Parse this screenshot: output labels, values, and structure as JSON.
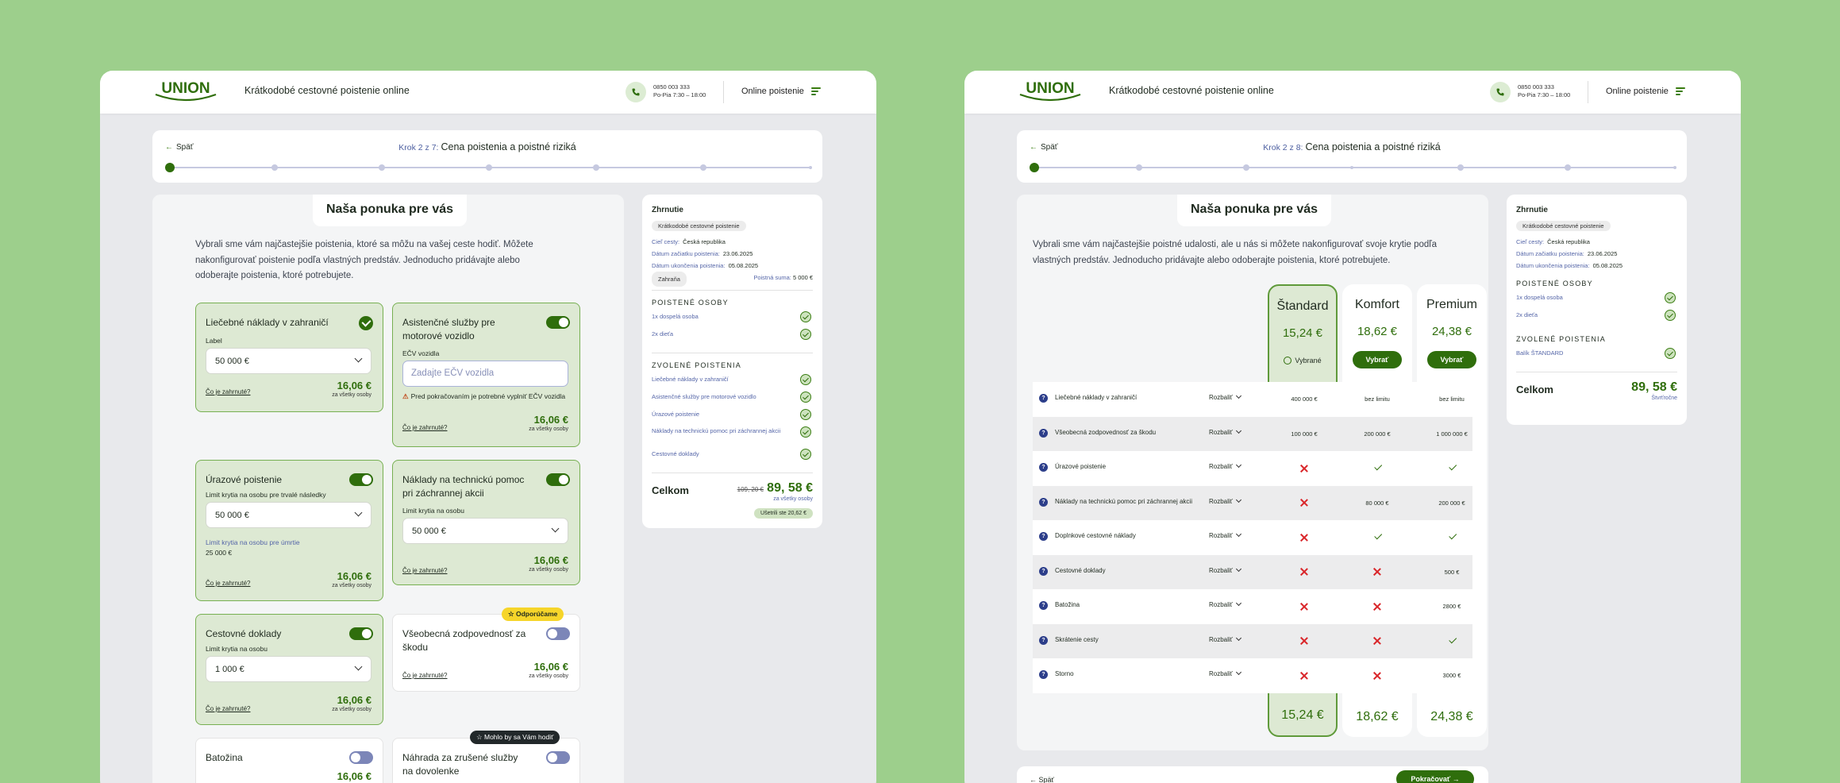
{
  "brand": {
    "logo": "UNION",
    "header_title": "Krátkodobé cestovné poistenie online",
    "phone": "0850 003 333",
    "hours": "Po-Pia 7:30 – 18:00",
    "menu_label": "Online poistenie",
    "accent": "#2f6e0c",
    "bg": "#9dcf8c"
  },
  "left": {
    "back": "Späť",
    "step_prefix": "Krok 2 z 7:",
    "step_title": "Cena poistenia a poistné riziká",
    "section_title": "Naša ponuka pre vás",
    "intro": "Vybrali sme vám najčastejšie poistenia, ktoré sa môžu na vašej ceste hodiť. Môžete nakonfigurovať poistenie podľa vlastných predstáv. Jednoducho pridávajte alebo odoberajte poistenia, ktoré potrebujete.",
    "cards": {
      "medical": {
        "title": "Liečebné náklady v zahraničí",
        "label": "Label",
        "value": "50 000 €",
        "price": "16,06 €",
        "per": "za všetky osoby",
        "link": "Čo je zahrnuté?"
      },
      "assist": {
        "title": "Asistenčné služby pre motorové vozidlo",
        "label": "EČV vozidla",
        "placeholder": "Zadajte EČV vozidla",
        "warning": "Pred pokračovaním je potrebné vyplniť EČV vozidla",
        "price": "16,06 €",
        "per": "za všetky osoby",
        "link": "Čo je zahrnuté?"
      },
      "injury": {
        "title": "Úrazové poistenie",
        "label": "Limit krytia na osobu pre trvalé následky",
        "value": "50 000 €",
        "label2": "Limit krytia na osobu pre úmrtie",
        "value2": "25 000 €",
        "price": "16,06 €",
        "per": "za všetky osoby",
        "link": "Čo je zahrnuté?"
      },
      "rescue": {
        "title": "Náklady na technickú pomoc pri záchrannej akcii",
        "label": "Limit krytia na osobu",
        "value": "50 000 €",
        "price": "16,06 €",
        "per": "za všetky osoby",
        "link": "Čo je zahrnuté?"
      },
      "docs": {
        "title": "Cestovné doklady",
        "label": "Limit krytia na osobu",
        "value": "1 000 €",
        "price": "16,06 €",
        "per": "za všetky osoby",
        "link": "Čo je zahrnuté?"
      },
      "liability": {
        "badge": "Odporúčame",
        "title": "Všeobecná zodpovednosť za škodu",
        "price": "16,06 €",
        "per": "za všetky osoby",
        "link": "Čo je zahrnuté?"
      },
      "luggage": {
        "title": "Batožina",
        "price": "16,06 €"
      },
      "cancel": {
        "badge": "Mohlo by sa Vám hodiť",
        "title": "Náhrada za zrušené služby na dovolenke"
      }
    },
    "summary": {
      "title": "Zhrnutie",
      "pill": "Krátkodobé cestovné poistenie",
      "dest_k": "Cieľ cesty:",
      "dest_v": "Česká republika",
      "start_k": "Dátum začiatku poistenia:",
      "start_v": "23.06.2025",
      "end_k": "Dátum ukončenia poistenia:",
      "end_v": "05.08.2025",
      "zone": "Zahraňa",
      "sum_k": "Poistná suma:",
      "sum_v": "5 000 €",
      "persons_h": "POISTENÉ OSOBY",
      "persons": [
        "1x dospelá osoba",
        "2x dieťa"
      ],
      "chosen_h": "ZVOLENÉ POISTENIA",
      "chosen": [
        "Liečebné náklady v zahraničí",
        "Asistenčné služby pre motorové vozidlo",
        "Úrazové poistenie",
        "Náklady na technickú pomoc pri záchrannej akcii",
        "Cestovné doklady"
      ],
      "total_l": "Celkom",
      "old": "109, 20 €",
      "total": "89, 58 €",
      "per": "za všetky osoby",
      "save": "Ušetrili ste 20,62 €"
    }
  },
  "right": {
    "back": "Späť",
    "step_prefix": "Krok 2 z 8:",
    "step_title": "Cena poistenia a poistné riziká",
    "section_title": "Naša ponuka pre vás",
    "intro": "Vybrali sme vám najčastejšie poistné udalosti, ale u nás si môžete nakonfigurovať svoje krytie podľa vlastných predstáv. Jednoducho pridávajte alebo odoberajte poistenia, ktoré potrebujete.",
    "plans": [
      {
        "name": "Štandard",
        "price": "15,24 €",
        "state": "Vybrané"
      },
      {
        "name": "Komfort",
        "price": "18,62 €",
        "button": "Vybrať"
      },
      {
        "name": "Premium",
        "price": "24,38 €",
        "button": "Vybrať"
      }
    ],
    "expand": "Rozbaliť",
    "rows": [
      {
        "label": "Liečebné náklady v zahraničí",
        "cells": [
          "400 000 €",
          "bez limitu",
          "bez limitu"
        ]
      },
      {
        "label": "Všeobecná zodpovednosť za škodu",
        "cells": [
          "100 000 €",
          "200 000 €",
          "1 000 000 €"
        ]
      },
      {
        "label": "Úrazové poistenie",
        "cells": [
          "x",
          "v",
          "v"
        ]
      },
      {
        "label": "Náklady na technickú pomoc pri záchrannej akcii",
        "cells": [
          "x",
          "80 000 €",
          "200 000 €"
        ]
      },
      {
        "label": "Doplnkové cestovné náklady",
        "cells": [
          "x",
          "v",
          "v"
        ]
      },
      {
        "label": "Cestovné doklady",
        "cells": [
          "x",
          "x",
          "500 €"
        ]
      },
      {
        "label": "Batožina",
        "cells": [
          "x",
          "x",
          "2800 €"
        ]
      },
      {
        "label": "Skrátenie cesty",
        "cells": [
          "x",
          "x",
          "v"
        ]
      },
      {
        "label": "Storno",
        "cells": [
          "x",
          "x",
          "3000 €"
        ]
      }
    ],
    "summary": {
      "title": "Zhrnutie",
      "pill": "Krátkodobé cestovné poistenie",
      "dest_k": "Cieľ cesty:",
      "dest_v": "Česká republika",
      "start_k": "Dátum začiatku poistenia:",
      "start_v": "23.06.2025",
      "end_k": "Dátum ukončenia poistenia:",
      "end_v": "05.08.2025",
      "persons_h": "POISTENÉ OSOBY",
      "persons": [
        "1x dospelá osoba",
        "2x dieťa"
      ],
      "chosen_h": "ZVOLENÉ POISTENIA",
      "chosen": [
        "Balík ŠTANDARD"
      ],
      "total_l": "Celkom",
      "total": "89, 58 €",
      "per": "Štvrťročne"
    },
    "footer": {
      "back": "Späť",
      "next": "Pokračovať"
    }
  }
}
